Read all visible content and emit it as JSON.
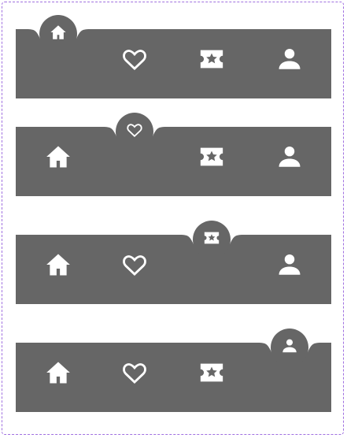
{
  "colors": {
    "bar": "#666666",
    "icon": "#ffffff",
    "background": "#ffffff",
    "border": "#a070e0"
  },
  "navbars": [
    {
      "active_index": 0,
      "items": [
        {
          "icon": "home-icon"
        },
        {
          "icon": "heart-icon"
        },
        {
          "icon": "ticket-icon"
        },
        {
          "icon": "user-icon"
        }
      ]
    },
    {
      "active_index": 1,
      "items": [
        {
          "icon": "home-icon"
        },
        {
          "icon": "heart-icon"
        },
        {
          "icon": "ticket-icon"
        },
        {
          "icon": "user-icon"
        }
      ]
    },
    {
      "active_index": 2,
      "items": [
        {
          "icon": "home-icon"
        },
        {
          "icon": "heart-icon"
        },
        {
          "icon": "ticket-icon"
        },
        {
          "icon": "user-icon"
        }
      ]
    },
    {
      "active_index": 3,
      "items": [
        {
          "icon": "home-icon"
        },
        {
          "icon": "heart-icon"
        },
        {
          "icon": "ticket-icon"
        },
        {
          "icon": "user-icon"
        }
      ]
    }
  ]
}
